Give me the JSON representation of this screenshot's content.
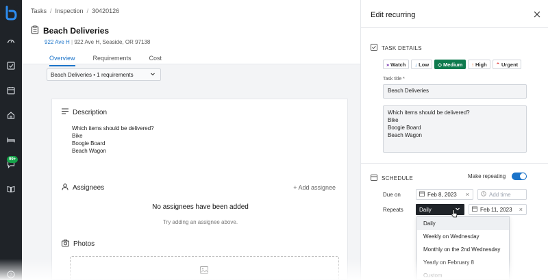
{
  "app": {
    "brand_color": "#1a73c9",
    "accent_green": "#0f7b4e"
  },
  "sidebar": {
    "items": [
      {
        "icon": "gauge-icon"
      },
      {
        "icon": "checkbox-icon"
      },
      {
        "icon": "calendar-icon"
      },
      {
        "icon": "home-icon"
      },
      {
        "icon": "bed-icon"
      },
      {
        "icon": "chat-icon",
        "badge": "99+"
      },
      {
        "icon": "book-icon"
      },
      {
        "icon": "help-icon"
      }
    ]
  },
  "main": {
    "breadcrumb": [
      "Tasks",
      "Inspection",
      "30420126"
    ],
    "title": "Beach Deliveries",
    "address_link": "922 Ave H",
    "address_sep": "|",
    "address": "922 Ave H, Seaside, OR 97138",
    "tabs": [
      {
        "label": "Overview",
        "active": true
      },
      {
        "label": "Requirements"
      },
      {
        "label": "Cost"
      }
    ],
    "requirements_select": "Beach Deliveries • 1 requirements",
    "description": {
      "heading": "Description",
      "lines": [
        "Which items should be delivered?",
        "Bike",
        "Boogie Board",
        "Beach Wagon"
      ]
    },
    "assignees": {
      "heading": "Assignees",
      "add_label": "+ Add assignee",
      "empty_title": "No assignees have been added",
      "empty_sub": "Try adding an assignee above."
    },
    "photos": {
      "heading": "Photos"
    }
  },
  "panel": {
    "title": "Edit recurring",
    "task_details_label": "TASK DETAILS",
    "priorities": [
      {
        "label": "Watch",
        "icon": "»"
      },
      {
        "label": "Low",
        "icon": "↓"
      },
      {
        "label": "Medium",
        "icon": "◇",
        "selected": true
      },
      {
        "label": "High",
        "icon": "↑"
      },
      {
        "label": "Urgent",
        "icon": "⌃"
      }
    ],
    "task_title_label": "Task title *",
    "task_title_value": "Beach Deliveries",
    "description_lines": [
      "Which items should be delivered?",
      "Bike",
      "Boogie Board",
      "Beach Wagon"
    ],
    "schedule_label": "SCHEDULE",
    "make_repeating_label": "Make repeating",
    "make_repeating_on": true,
    "due_on_label": "Due on",
    "due_on_value": "Feb 8, 2023",
    "add_time_placeholder": "Add time",
    "repeats_label": "Repeats",
    "repeats_value": "Daily",
    "repeats_until_value": "Feb 11, 2023",
    "repeat_options": [
      "Daily",
      "Weekly on Wednesday",
      "Monthly on the 2nd Wednesday",
      "Yearly on February 8",
      "Custom"
    ]
  }
}
